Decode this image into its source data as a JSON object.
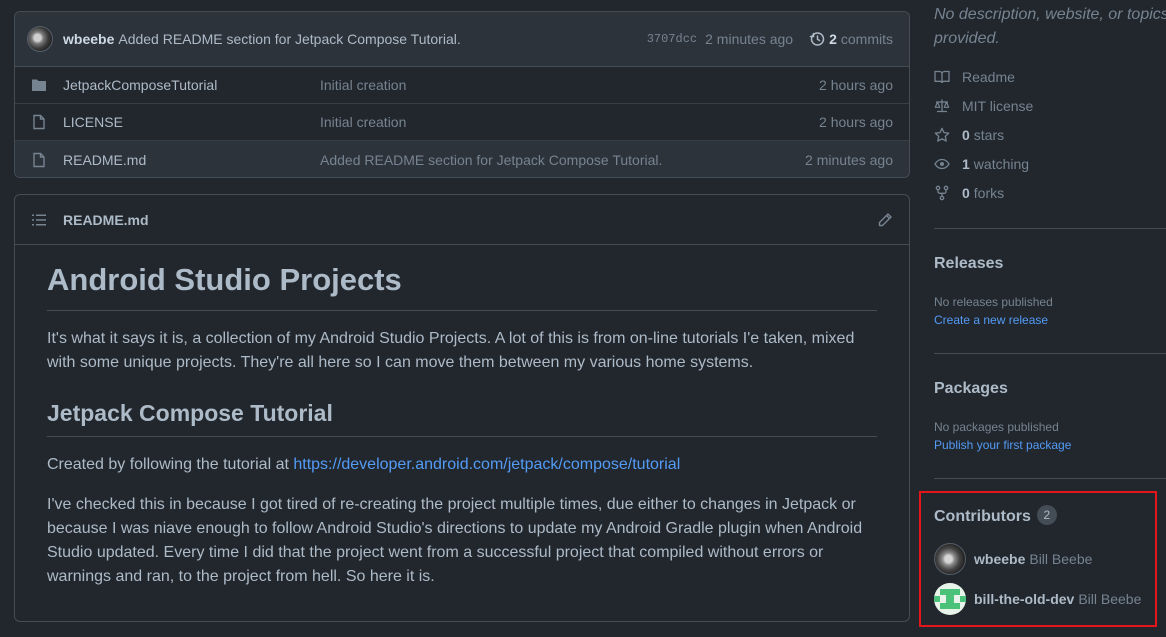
{
  "latest_commit": {
    "author": "wbeebe",
    "message": "Added README section for Jetpack Compose Tutorial.",
    "sha": "3707dcc",
    "time": "2 minutes ago",
    "commit_count": "2",
    "commits_label": "commits"
  },
  "files": [
    {
      "type": "folder",
      "name": "JetpackComposeTutorial",
      "message": "Initial creation",
      "time": "2 hours ago"
    },
    {
      "type": "file",
      "name": "LICENSE",
      "message": "Initial creation",
      "time": "2 hours ago"
    },
    {
      "type": "file",
      "name": "README.md",
      "message": "Added README section for Jetpack Compose Tutorial.",
      "time": "2 minutes ago"
    }
  ],
  "readme": {
    "filename": "README.md",
    "h1": "Android Studio Projects",
    "p1": "It's what it says it is, a collection of my Android Studio Projects. A lot of this is from on-line tutorials I'e taken, mixed with some unique projects. They're all here so I can move them between my various home systems.",
    "h2": "Jetpack Compose Tutorial",
    "p2_prefix": "Created by following the tutorial at ",
    "p2_link": "https://developer.android.com/jetpack/compose/tutorial",
    "p3": "I've checked this in because I got tired of re-creating the project multiple times, due either to changes in Jetpack or because I was niave enough to follow Android Studio's directions to update my Android Gradle plugin when Android Studio updated. Every time I did that the project went from a successful project that compiled without errors or warnings and ran, to the project from hell. So here it is."
  },
  "about": {
    "description": "No description, website, or topics provided.",
    "readme": "Readme",
    "license": "MIT license",
    "stars_count": "0",
    "stars_label": "stars",
    "watching_count": "1",
    "watching_label": "watching",
    "forks_count": "0",
    "forks_label": "forks"
  },
  "releases": {
    "title": "Releases",
    "empty": "No releases published",
    "link": "Create a new release"
  },
  "packages": {
    "title": "Packages",
    "empty": "No packages published",
    "link": "Publish your first package"
  },
  "contributors": {
    "title": "Contributors",
    "count": "2",
    "list": [
      {
        "login": "wbeebe",
        "name": "Bill Beebe"
      },
      {
        "login": "bill-the-old-dev",
        "name": "Bill Beebe"
      }
    ]
  },
  "colors": {
    "background": "#22272e",
    "link": "#539bf5",
    "highlight_frame": "#e5161b"
  }
}
